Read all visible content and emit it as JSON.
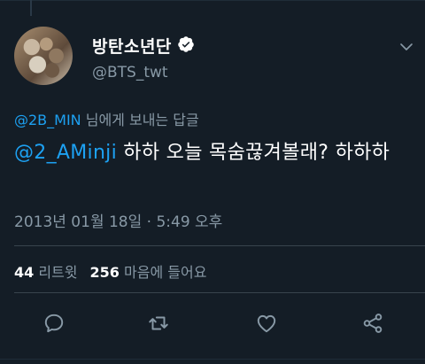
{
  "tweet": {
    "display_name": "방탄소년단",
    "handle": "@BTS_twt",
    "reply_to_mention": "@2B_MIN",
    "reply_to_suffix": " 님에게 보내는 답글",
    "text_mention": "@2_AMinji",
    "text_body": " 하하 오늘 목숨끊겨볼래? 하하하",
    "timestamp": "2013년 01월 18일 · 5:49 오후"
  },
  "stats": {
    "retweets": "44",
    "retweets_label": "리트윗",
    "likes": "256",
    "likes_label": "마음에 들어요"
  },
  "icons": {
    "verified": "verified-badge-icon",
    "more": "chevron-down-icon",
    "reply": "reply-icon",
    "retweet": "retweet-icon",
    "like": "heart-icon",
    "share": "share-icon"
  },
  "colors": {
    "background": "#141d26",
    "link": "#1da1f2",
    "muted": "#8899a6",
    "divider": "#38444d"
  }
}
